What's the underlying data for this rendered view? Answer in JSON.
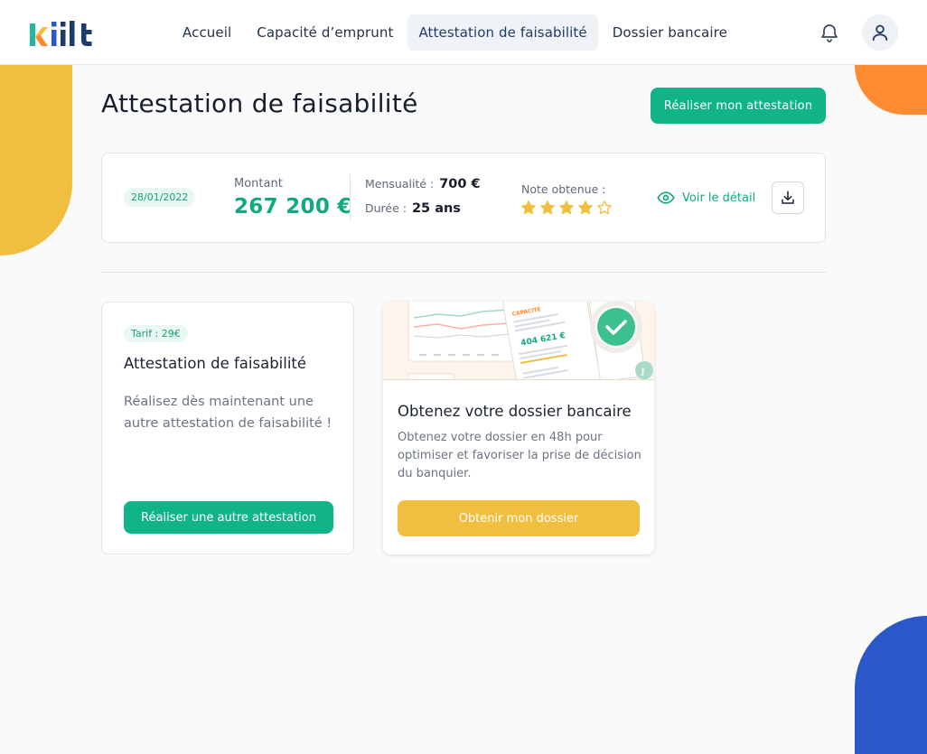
{
  "brand": {
    "logo_text": "kiilt"
  },
  "nav": {
    "items": [
      {
        "label": "Accueil"
      },
      {
        "label": "Capacité d’emprunt"
      },
      {
        "label": "Attestation de faisabilité"
      },
      {
        "label": "Dossier bancaire"
      }
    ],
    "active_index": 2
  },
  "page": {
    "title": "Attestation de faisabilité",
    "primary_button": "Réaliser mon attestation"
  },
  "summary": {
    "date": "28/01/2022",
    "amount_label": "Montant",
    "amount_value": "267 200 €",
    "mensualite_label": "Mensualité :",
    "mensualite_value": "700 €",
    "duree_label": "Durée :",
    "duree_value": "25 ans",
    "note_label": "Note obtenue :",
    "rating": 4,
    "rating_max": 5,
    "detail_link": "Voir le détail"
  },
  "card_attestation": {
    "badge": "Tarif : 29€",
    "title": "Attestation de faisabilité",
    "description": "Réalisez dès maintenant une autre attestation de faisabilité !",
    "button": "Réaliser une autre attestation"
  },
  "card_dossier": {
    "illustration_heading": "CAPACITÉ",
    "illustration_amount": "404 621 €",
    "title": "Obtenez votre dossier bancaire",
    "description": "Obtenez votre dossier en 48h pour optimiser et favoriser la prise de décision du banquier.",
    "button": "Obtenir mon dossier"
  },
  "colors": {
    "accent_green": "#10b488",
    "accent_yellow": "#f1bf3f",
    "accent_orange": "#fd8b31",
    "accent_blue": "#2a58c8",
    "star": "#f1bf3f"
  },
  "icons": [
    "bell-icon",
    "user-icon",
    "eye-icon",
    "download-icon",
    "star-icon",
    "check-icon"
  ]
}
